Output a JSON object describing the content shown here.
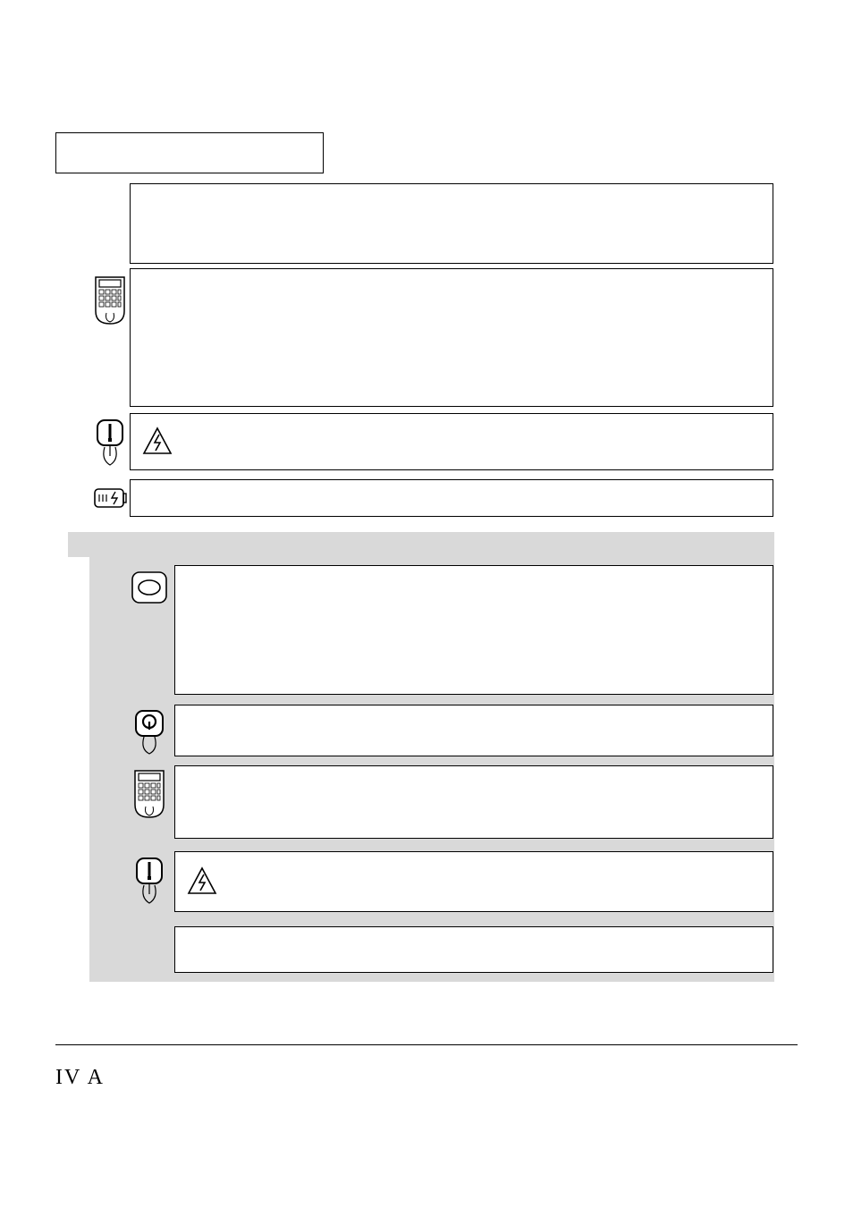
{
  "footer": {
    "label": "IV A"
  },
  "title_box": {
    "label": ""
  },
  "rows": [
    {
      "id": "r1",
      "text": ""
    },
    {
      "id": "r2",
      "text": ""
    },
    {
      "id": "r3",
      "text": "",
      "inner_icon": "warning-bolt-icon"
    },
    {
      "id": "r4",
      "text": ""
    },
    {
      "id": "s1",
      "text": ""
    },
    {
      "id": "s2",
      "text": ""
    },
    {
      "id": "s3",
      "text": ""
    },
    {
      "id": "s4",
      "text": "",
      "inner_icon": "warning-bolt-icon"
    },
    {
      "id": "s5",
      "text": ""
    }
  ],
  "left_icons": {
    "r2": "calculator-icon",
    "r3": "switch-on-icon",
    "r4": "battery-charge-icon",
    "s1": "ellipse-icon",
    "s2": "switch-off-icon",
    "s3": "calculator-icon",
    "s4": "switch-on-icon"
  }
}
